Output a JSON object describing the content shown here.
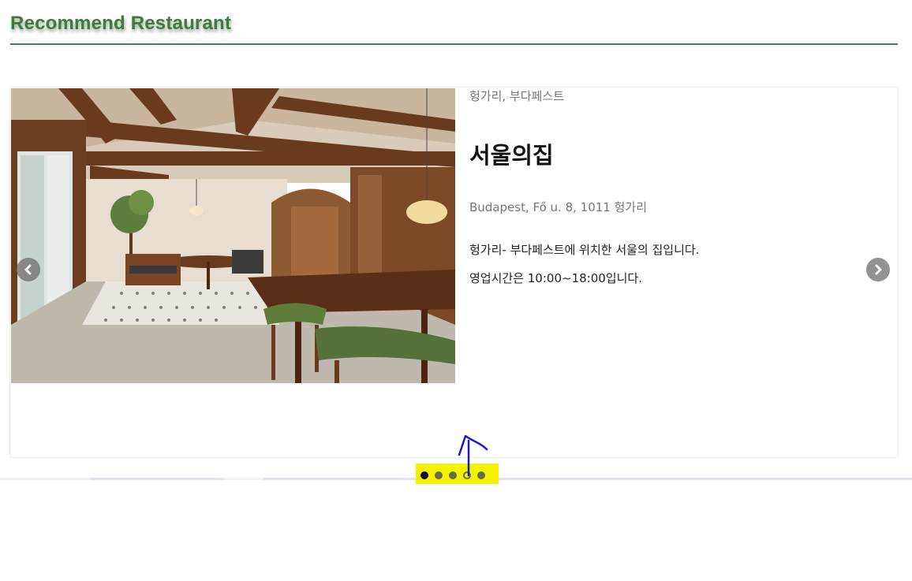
{
  "section": {
    "title": "Recommend Restaurant"
  },
  "restaurant": {
    "region": "헝가리, 부다페스트",
    "name": "서울의집",
    "address": "Budapest, Fő u. 8, 1011 헝가리",
    "description_lines": [
      "헝가리- 부다페스트에 위치한 서울의 집입니다.",
      "영업시간은 10:00~18:00입니다."
    ]
  },
  "carousel": {
    "prev_icon": "chevron-left-icon",
    "next_icon": "chevron-right-icon",
    "dot_count": 5,
    "active_index": 0
  },
  "colors": {
    "title_green": "#3f7a3f",
    "highlight": "#f5f200",
    "annotation_arrow": "#1a1acc"
  }
}
